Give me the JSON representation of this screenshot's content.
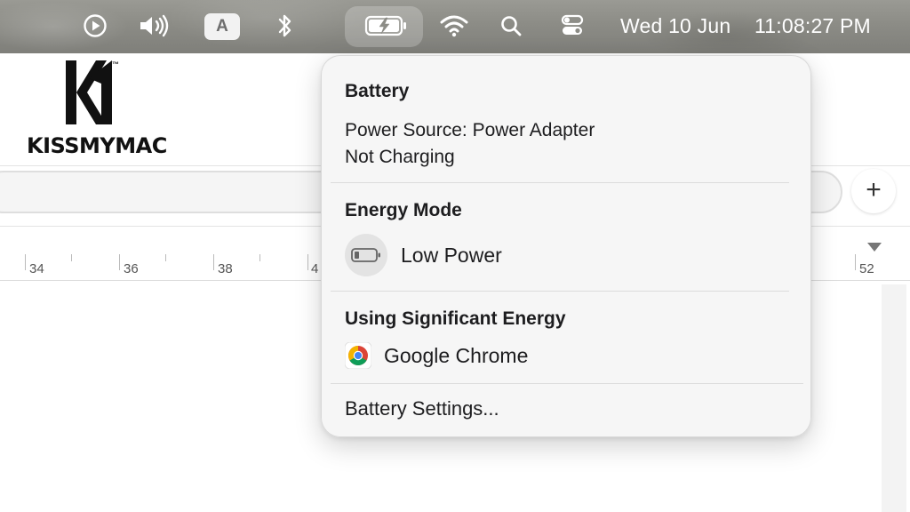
{
  "menubar": {
    "keyboard_input_label": "A",
    "date": "Wed 10 Jun",
    "time": "11:08:27 PM",
    "icons": [
      "play-circle-icon",
      "volume-icon",
      "keyboard-input-icon",
      "bluetooth-icon",
      "battery-charging-icon",
      "wifi-icon",
      "search-icon",
      "control-center-icon"
    ]
  },
  "background_app": {
    "logo_text": "KISSMYMAC",
    "logo_tm": "™",
    "add_button_label": "+",
    "ruler_numbers": [
      "34",
      "36",
      "38",
      "4",
      "52"
    ]
  },
  "battery_popover": {
    "title": "Battery",
    "power_source": "Power Source: Power Adapter",
    "charging_status": "Not Charging",
    "energy_mode_heading": "Energy Mode",
    "energy_mode_option": "Low Power",
    "significant_energy_heading": "Using Significant Energy",
    "apps": [
      {
        "name": "Google Chrome",
        "icon": "chrome-icon"
      }
    ],
    "settings_link": "Battery Settings..."
  },
  "colors": {
    "menubar_bg": "#8c8c86",
    "popover_bg": "#f6f6f6",
    "text": "#1d1d1f"
  }
}
